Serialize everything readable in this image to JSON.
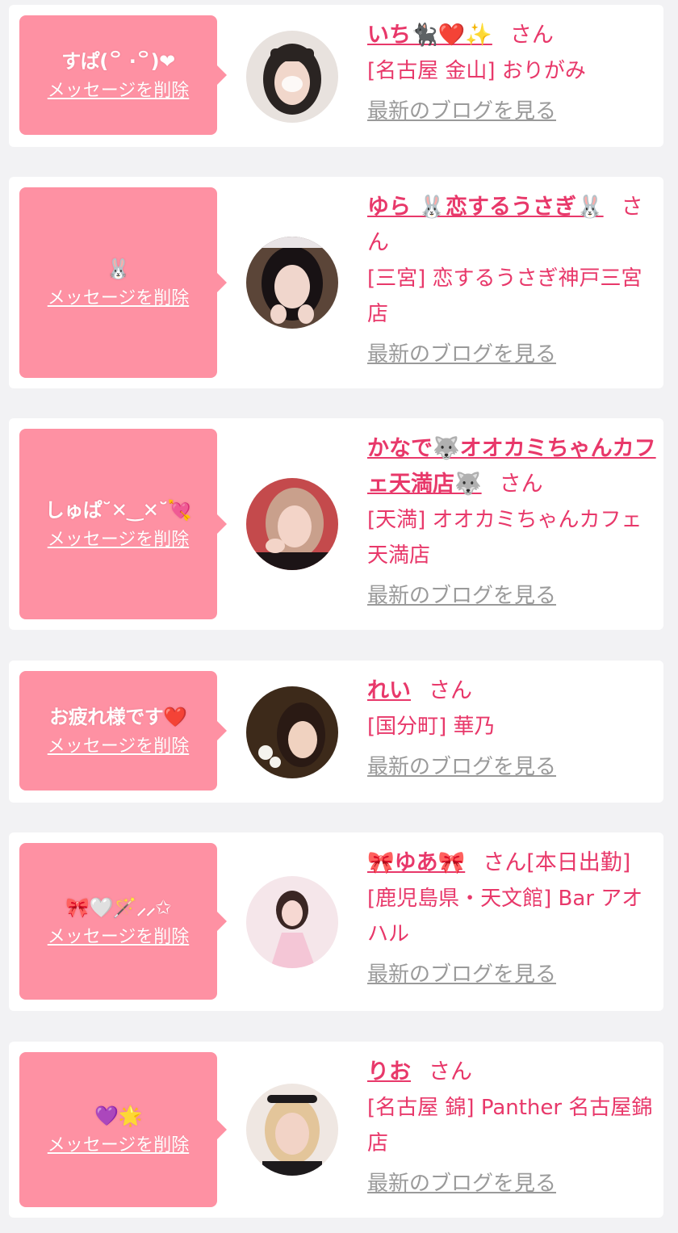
{
  "favorites": {
    "items": [
      {
        "message": "すぱ(꒪ ·꒪)❤",
        "delete_label": "メッセージを削除",
        "girl_name": "いち🐈‍⬛❤️✨",
        "honorific": "さん",
        "badge": "",
        "shop": "[名古屋 金山] おりがみ",
        "blog_link": "最新のブログを見る",
        "avatar_tones": [
          "#e8e2de",
          "#2a2422",
          "#f1d7cb",
          "#ffffff"
        ]
      },
      {
        "message": "🐰",
        "delete_label": "メッセージを削除",
        "girl_name": "ゆら 🐰恋するうさぎ🐰",
        "honorific": "さん",
        "badge": "",
        "shop": "[三宮] 恋するうさぎ神戸三宮店",
        "blog_link": "最新のブログを見る",
        "avatar_tones": [
          "#5b4538",
          "#181214",
          "#f0d6cc",
          "#e9e4e6"
        ]
      },
      {
        "message": "しゅぱ˘✕‿✕˘💘",
        "delete_label": "メッセージを削除",
        "girl_name": "かなで🐺オオカミちゃんカフェ天満店🐺",
        "honorific": "さん",
        "badge": "",
        "shop": "[天満] オオカミちゃんカフェ天満店",
        "blog_link": "最新のブログを見る",
        "avatar_tones": [
          "#c44a4c",
          "#c9a08c",
          "#f3d4c8",
          "#1c1416"
        ]
      },
      {
        "message": "お疲れ様です❤️",
        "delete_label": "メッセージを削除",
        "girl_name": "れい",
        "honorific": "さん",
        "badge": "",
        "shop": "[国分町] 華乃",
        "blog_link": "最新のブログを見る",
        "avatar_tones": [
          "#3d2a1a",
          "#2a1a14",
          "#f0d2c0",
          "#f5f3ee"
        ]
      },
      {
        "message": "🎀🤍🪄⸝⸝✩",
        "delete_label": "メッセージを削除",
        "girl_name": "🎀ゆあ🎀",
        "honorific": "さん",
        "badge": "[本日出勤]",
        "shop": "[鹿児島県・天文館] Bar アオハル",
        "blog_link": "最新のブログを見る",
        "avatar_tones": [
          "#f5e6ea",
          "#3a2624",
          "#f6d8d2",
          "#f4c6d6"
        ]
      },
      {
        "message": "💜🌟",
        "delete_label": "メッセージを削除",
        "girl_name": "りお",
        "honorific": "さん",
        "badge": "",
        "shop": "[名古屋 錦] Panther 名古屋錦店",
        "blog_link": "最新のブログを見る",
        "avatar_tones": [
          "#efe7e2",
          "#1d1a1c",
          "#f2d3c6",
          "#e3c59a"
        ]
      }
    ]
  }
}
